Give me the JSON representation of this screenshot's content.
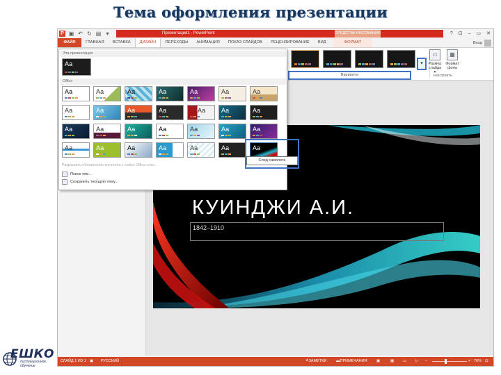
{
  "page_title": "Тема оформления презентации",
  "window": {
    "title": "Презентация1 - PowerPoint",
    "context_tools": "СРЕДСТВА РИСОВАНИЯ",
    "controls": [
      "?",
      "⊡",
      "–",
      "▭",
      "✕"
    ]
  },
  "tabs": {
    "file": "ФАЙЛ",
    "items": [
      "ГЛАВНАЯ",
      "ВСТАВКА",
      "ДИЗАЙН",
      "ПЕРЕХОДЫ",
      "АНИМАЦИЯ",
      "ПОКАЗ СЛАЙДОВ",
      "РЕЦЕНЗИРОВАНИЕ",
      "ВИД"
    ],
    "active": "ДИЗАЙН",
    "format": "ФОРМАТ",
    "signin": "Вход"
  },
  "ribbon": {
    "variants_label": "Варианты",
    "more_button": "▾",
    "slide_size": "Размер слайда ▾",
    "slide_size_l1": "Размер",
    "slide_size_l2": "слайда ▾",
    "format_bg_l1": "Формат",
    "format_bg_l2": "фона",
    "customize": "Настроить"
  },
  "gallery": {
    "this_presentation": "Эта презентация",
    "office_header": "Office",
    "tile_text": "Аа",
    "link_update": "Разрешить обновления контента с сайта Office.com...",
    "link_browse": "Поиск тем...",
    "link_save": "Сохранить текущую тему...",
    "tooltip": "След самолета"
  },
  "slide": {
    "heading": "КУИНДЖИ А.И.",
    "subtitle": "1842–1910"
  },
  "status": {
    "slide": "СЛАЙД 1 ИЗ 1",
    "lang": "РУССКИЙ",
    "notes": "ЗАМЕТКИ",
    "comments": "ПРИМЕЧАНИЯ",
    "zoom": "76%"
  },
  "logo": {
    "name": "ЕШКО",
    "tagline_l1": "дистанционное",
    "tagline_l2": "обучение"
  },
  "colors": {
    "accent": "#d24726",
    "highlight": "#3e74c4",
    "title": "#17375e"
  }
}
